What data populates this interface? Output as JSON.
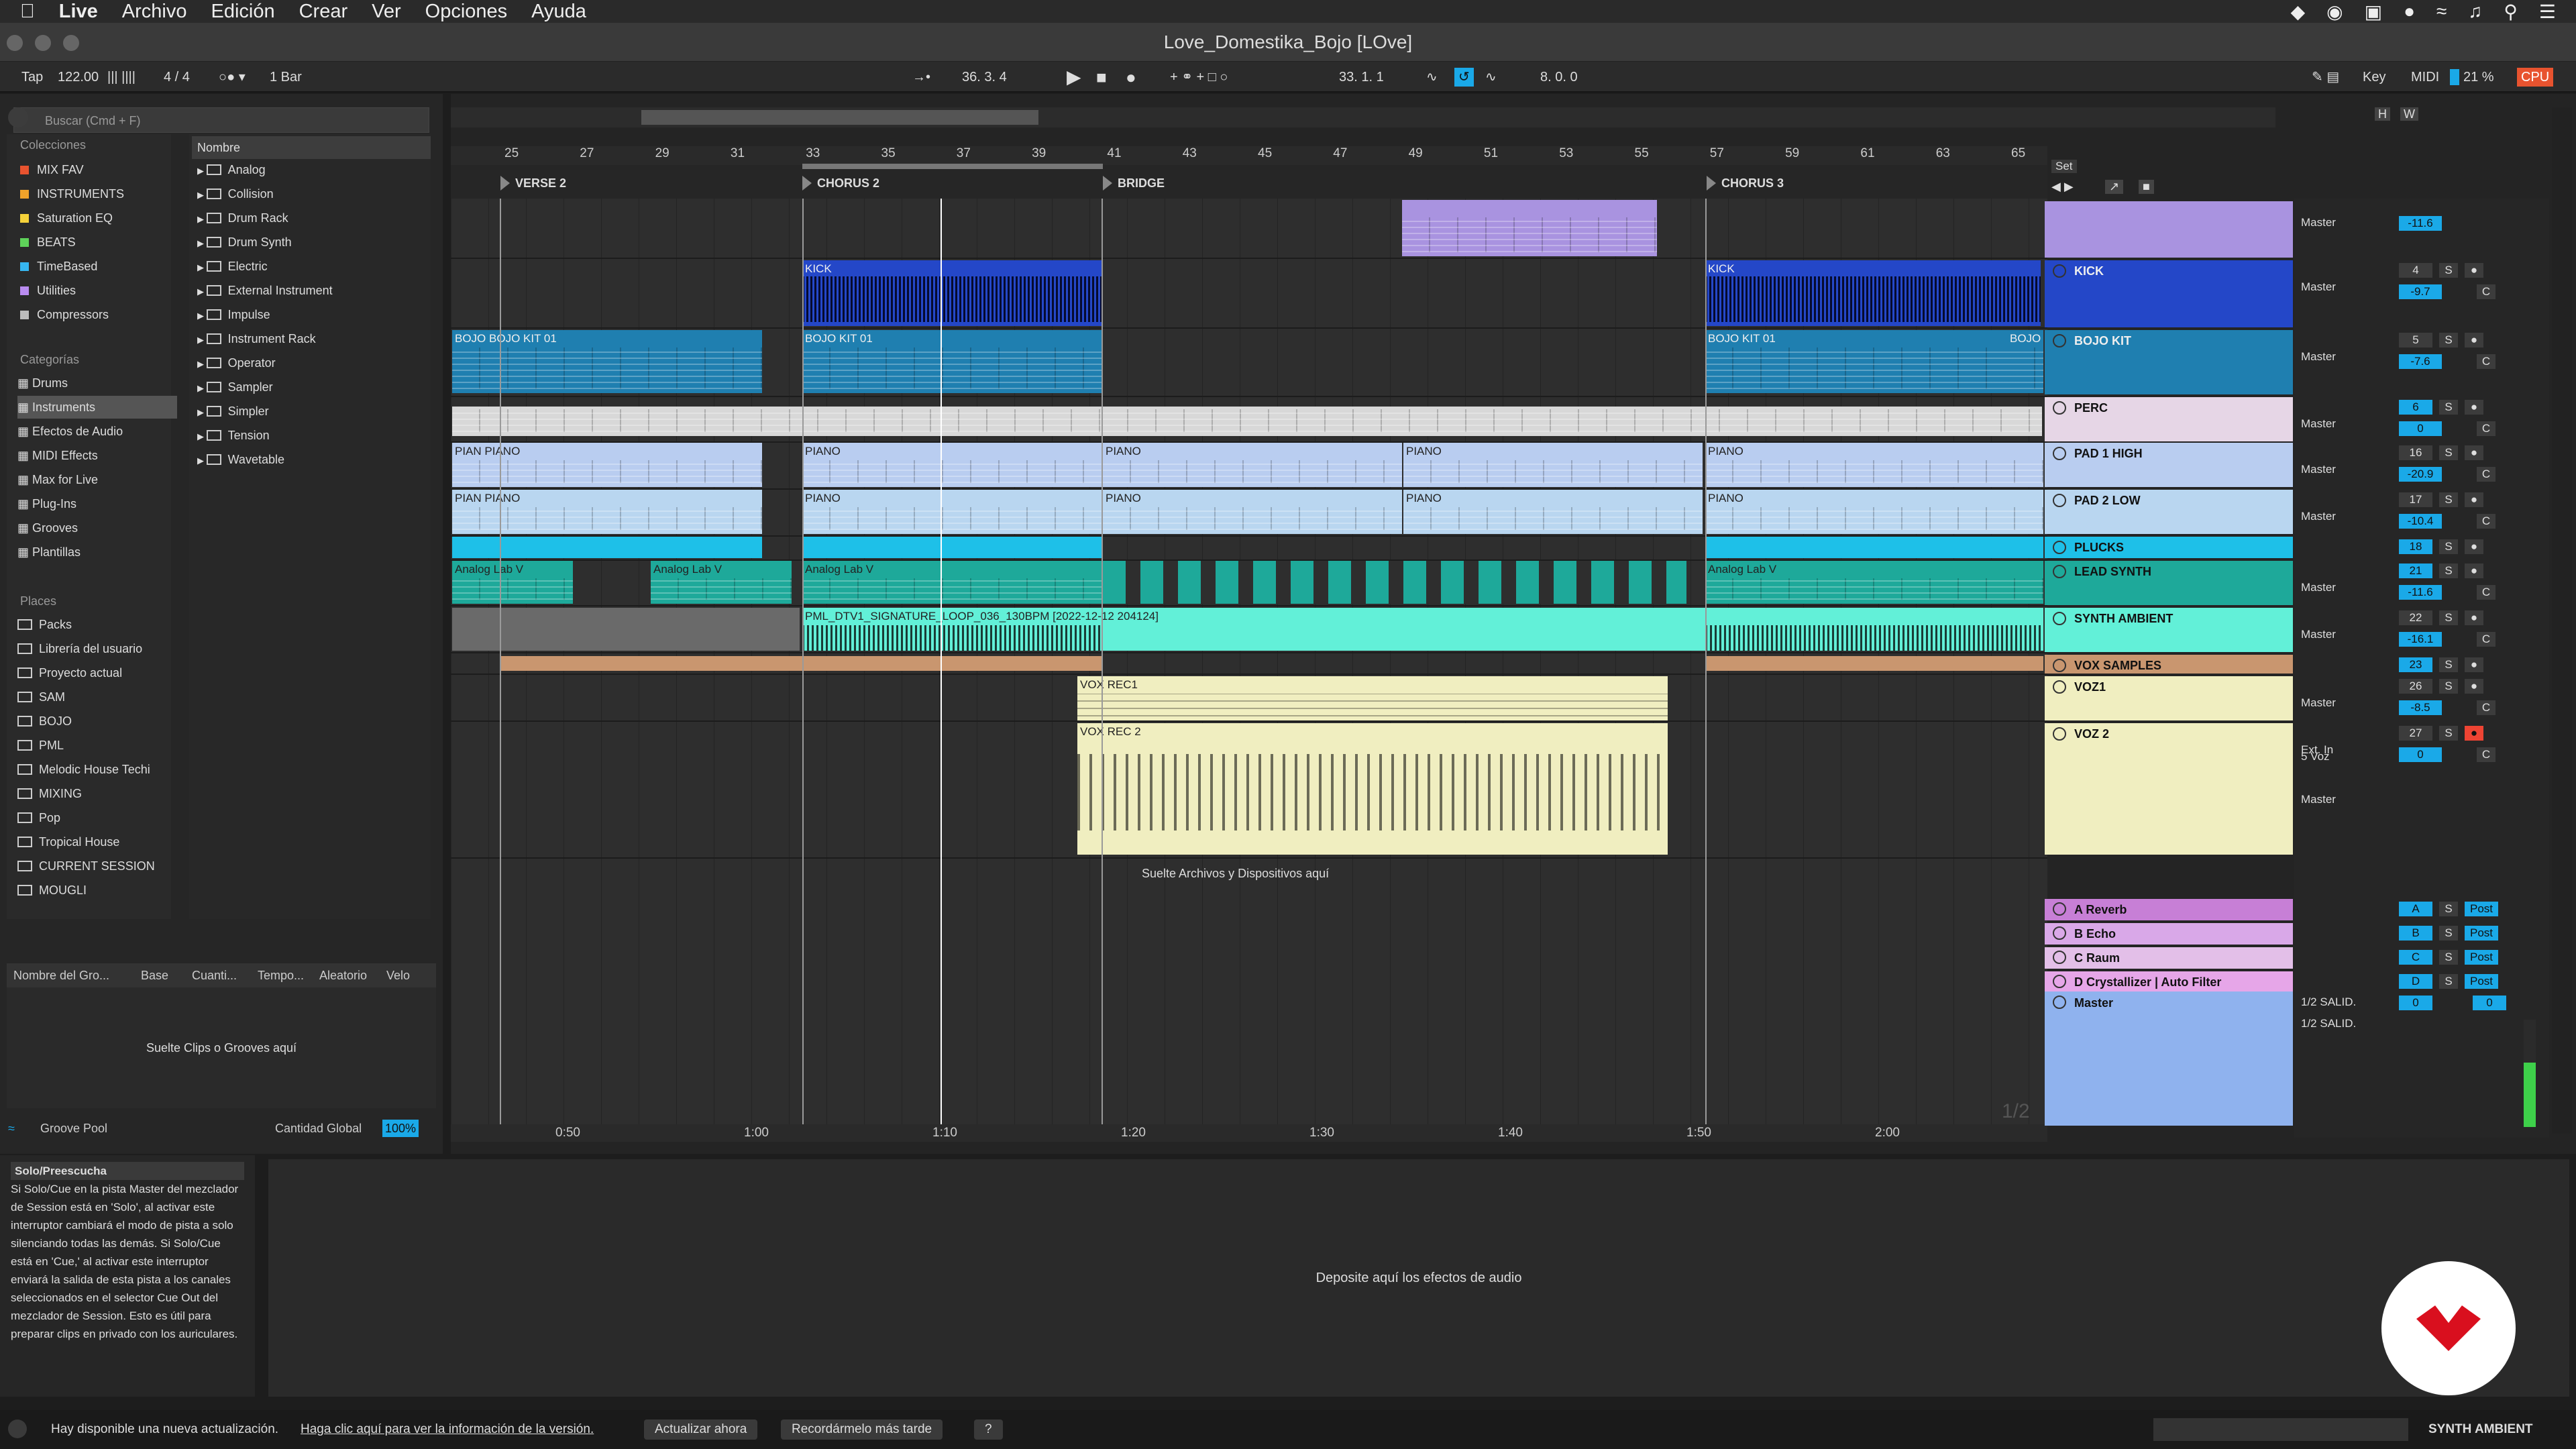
{
  "macmenu": {
    "apple": "",
    "app": "Live",
    "items": [
      "Archivo",
      "Edición",
      "Crear",
      "Ver",
      "Opciones",
      "Ayuda"
    ]
  },
  "title": "Love_Domestika_Bojo  [LOve]",
  "control": {
    "tap": "Tap",
    "tempo": "122.00",
    "meter": "4 / 4",
    "quant": "1 Bar",
    "pos": "36.  3.  4",
    "loop_start": "33.  1.  1",
    "loop_len": "8.  0.  0",
    "key": "Key",
    "midi": "MIDI",
    "cpu_pct": "21 %",
    "cpu": "CPU"
  },
  "browser": {
    "search": "Buscar (Cmd + F)",
    "colecciones_title": "Colecciones",
    "colecciones": [
      {
        "label": "MIX FAV",
        "color": "#e8532f"
      },
      {
        "label": "INSTRUMENTS",
        "color": "#f0a22a"
      },
      {
        "label": "Saturation EQ",
        "color": "#f5d23a"
      },
      {
        "label": "BEATS",
        "color": "#5fd35a"
      },
      {
        "label": "TimeBased",
        "color": "#36b6f0"
      },
      {
        "label": "Utilities",
        "color": "#b98cf0"
      },
      {
        "label": "Compressors",
        "color": "#bdbdbd"
      }
    ],
    "categorias_title": "Categorías",
    "categorias": [
      "Drums",
      "Instruments",
      "Efectos de Audio",
      "MIDI Effects",
      "Max for Live",
      "Plug-Ins",
      "Grooves",
      "Plantillas"
    ],
    "places_title": "Places",
    "places": [
      "Packs",
      "Librería del usuario",
      "Proyecto actual",
      "SAM",
      "BOJO",
      "PML",
      "Melodic House Techi",
      "MIXING",
      "Pop",
      "Tropical House",
      "CURRENT SESSION",
      "MOUGLI"
    ],
    "name_header": "Nombre",
    "names": [
      "Analog",
      "Collision",
      "Drum Rack",
      "Drum Synth",
      "Electric",
      "External Instrument",
      "Impulse",
      "Instrument Rack",
      "Operator",
      "Sampler",
      "Simpler",
      "Tension",
      "Wavetable"
    ]
  },
  "groove": {
    "headers": [
      "Nombre del Gro...",
      "Base",
      "Cuanti...",
      "Tempo...",
      "Aleatorio",
      "Velo"
    ],
    "drop": "Suelte Clips o Grooves aquí",
    "pool": "Groove Pool",
    "global": "Cantidad Global",
    "global_val": "100%"
  },
  "ruler": [
    "25",
    "27",
    "29",
    "31",
    "33",
    "35",
    "37",
    "39",
    "41",
    "43",
    "45",
    "47",
    "49",
    "51",
    "53",
    "55",
    "57",
    "59",
    "61",
    "63",
    "65"
  ],
  "locators": [
    "VERSE 2",
    "CHORUS 2",
    "BRIDGE",
    "CHORUS 3"
  ],
  "set_label": "Set",
  "clips": {
    "kick": "KICK",
    "bojo1": "BOJO BOJO KIT 01",
    "bojo2": "BOJO KIT 01",
    "bojo3": "BOJO KIT 01",
    "bojo4": "BOJO",
    "piano": "PIANO",
    "pianoA": "PIAN PIANO",
    "analog": "Analog Lab V",
    "synth_loop": "PML_DTV1_SIGNATURE_LOOP_036_130BPM [2022-12-12 204124]",
    "voxrec1": "VOX REC1",
    "voxrec2": "VOX REC 2",
    "drop_files": "Suelte Archivos y Dispositivos aquí"
  },
  "tracks": [
    {
      "name": "KICK",
      "color": "#2447c8",
      "out": "Master",
      "num": "4",
      "vol": "-9.7"
    },
    {
      "name": "BOJO KIT",
      "color": "#1f7fb0",
      "out": "Master",
      "num": "5",
      "vol": "-7.6"
    },
    {
      "name": "PERC",
      "color": "#e6d6e6",
      "out": "Master",
      "num": "6",
      "vol": "0"
    },
    {
      "name": "PAD 1 HIGH",
      "color": "#b9cdf0",
      "out": "Master",
      "num": "16",
      "vol": "-20.9"
    },
    {
      "name": "PAD 2 LOW",
      "color": "#b9d6f0",
      "out": "Master",
      "num": "17",
      "vol": "-10.4"
    },
    {
      "name": "PLUCKS",
      "color": "#1ec0e8",
      "out": "",
      "num": "18",
      "vol": ""
    },
    {
      "name": "LEAD SYNTH",
      "color": "#1ea99a",
      "out": "Master",
      "num": "21",
      "vol": "-11.6"
    },
    {
      "name": "SYNTH AMBIENT",
      "color": "#62f0d8",
      "out": "Master",
      "num": "22",
      "vol": "-16.1"
    },
    {
      "name": "VOX SAMPLES",
      "color": "#c9966f",
      "out": "",
      "num": "23",
      "vol": ""
    },
    {
      "name": "VOZ1",
      "color": "#f0eec0",
      "out": "Master",
      "num": "26",
      "vol": "-8.5"
    },
    {
      "name": "VOZ 2",
      "color": "#f0eec0",
      "out": "Ext. In",
      "num": "27",
      "vol": "0"
    }
  ],
  "top_track": {
    "out": "Master",
    "vol": "-11.6"
  },
  "voz2_extra": {
    "in2": "5 Voz",
    "out2": "Master"
  },
  "returns": [
    {
      "name": "A Reverb",
      "letter": "A"
    },
    {
      "name": "B Echo",
      "letter": "B"
    },
    {
      "name": "C Raum",
      "letter": "C"
    },
    {
      "name": "D Crystallizer | Auto Filter",
      "letter": "D"
    }
  ],
  "master": {
    "name": "Master",
    "out1": "1/2 SALID.",
    "out2": "1/2 SALID.",
    "val": "0"
  },
  "time_labels": [
    "0:50",
    "1:00",
    "1:10",
    "1:20",
    "1:30",
    "1:40",
    "1:50",
    "2:00"
  ],
  "page_ind": "1/2",
  "help": {
    "title": "Solo/Preescucha",
    "body": "Si Solo/Cue en la pista Master del mezclador de Session está en 'Solo', al activar este interruptor cambiará el modo de pista a solo silenciando todas las demás. Si Solo/Cue está en 'Cue,' al activar este interruptor enviará la salida de esta pista a los canales seleccionados en el selector Cue Out del mezclador de Session. Esto es útil para preparar clips en privado con los auriculares."
  },
  "device_drop": "Deposite aquí los efectos de audio",
  "status": {
    "msg": "Hay disponible una nueva actualización.",
    "link": "Haga clic aquí para ver la información de la versión.",
    "update": "Actualizar ahora",
    "later": "Recordármelo más tarde",
    "q": "?",
    "track": "SYNTH AMBIENT"
  }
}
